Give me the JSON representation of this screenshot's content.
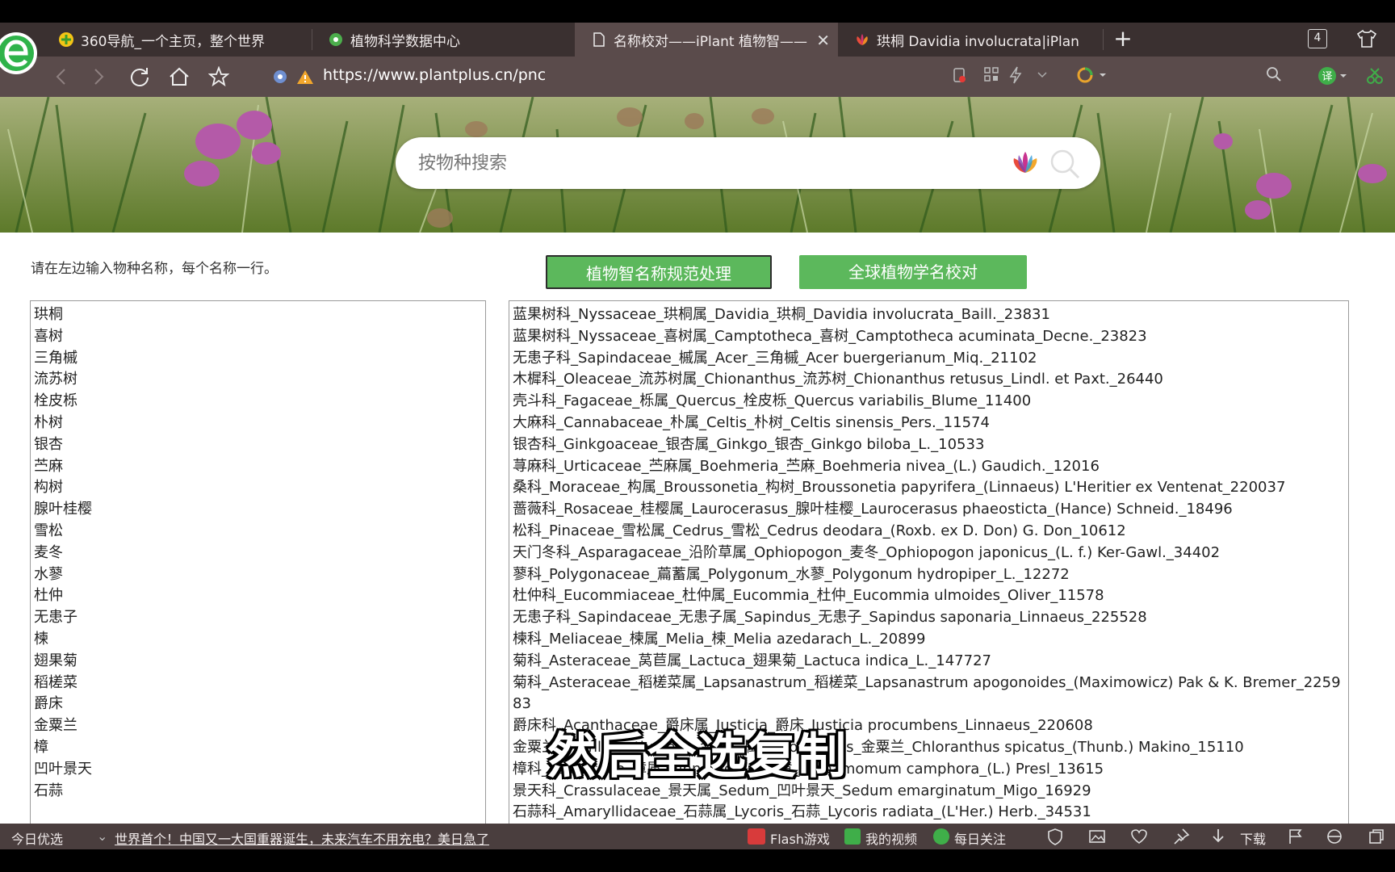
{
  "browser": {
    "tabs": [
      {
        "label": "360导航_一个主页，整个世界",
        "icon": "360-nav-icon"
      },
      {
        "label": "植物科学数据中心",
        "icon": "plant-data-icon"
      },
      {
        "label": "名称校对——iPlant 植物智——",
        "icon": "page-icon"
      },
      {
        "label": "珙桐 Davidia involucrata|iPlant",
        "icon": "lotus-icon"
      }
    ],
    "tab_count": "4",
    "url": "https://www.plantplus.cn/pnc"
  },
  "search": {
    "placeholder": "按物种搜索"
  },
  "page": {
    "hint": "请在左边输入物种名称，每个名称一行。",
    "button_normalize": "植物智名称规范处理",
    "button_global": "全球植物学名校对"
  },
  "input_names": [
    "珙桐",
    "喜树",
    "三角槭",
    "流苏树",
    "栓皮栎",
    "朴树",
    "银杏",
    "苎麻",
    "构树",
    "腺叶桂樱",
    "雪松",
    "麦冬",
    "水蓼",
    "杜仲",
    "无患子",
    "楝",
    "翅果菊",
    "稻槎菜",
    "爵床",
    "金粟兰",
    "樟",
    "凹叶景天",
    "石蒜"
  ],
  "results": [
    "蓝果树科_Nyssaceae_珙桐属_Davidia_珙桐_Davidia involucrata_Baill._23831",
    "蓝果树科_Nyssaceae_喜树属_Camptotheca_喜树_Camptotheca acuminata_Decne._23823",
    "无患子科_Sapindaceae_槭属_Acer_三角槭_Acer buergerianum_Miq._21102",
    "木樨科_Oleaceae_流苏树属_Chionanthus_流苏树_Chionanthus retusus_Lindl. et Paxt._26440",
    "壳斗科_Fagaceae_栎属_Quercus_栓皮栎_Quercus variabilis_Blume_11400",
    "大麻科_Cannabaceae_朴属_Celtis_朴树_Celtis sinensis_Pers._11574",
    "银杏科_Ginkgoaceae_银杏属_Ginkgo_银杏_Ginkgo biloba_L._10533",
    "荨麻科_Urticaceae_苎麻属_Boehmeria_苎麻_Boehmeria nivea_(L.) Gaudich._12016",
    "桑科_Moraceae_构属_Broussonetia_构树_Broussonetia papyrifera_(Linnaeus) L'Heritier ex Ventenat_220037",
    "蔷薇科_Rosaceae_桂樱属_Laurocerasus_腺叶桂樱_Laurocerasus phaeosticta_(Hance) Schneid._18496",
    "松科_Pinaceae_雪松属_Cedrus_雪松_Cedrus deodara_(Roxb. ex D. Don) G. Don_10612",
    "天门冬科_Asparagaceae_沿阶草属_Ophiopogon_麦冬_Ophiopogon japonicus_(L. f.) Ker-Gawl._34402",
    "蓼科_Polygonaceae_萹蓄属_Polygonum_水蓼_Polygonum hydropiper_L._12272",
    "杜仲科_Eucommiaceae_杜仲属_Eucommia_杜仲_Eucommia ulmoides_Oliver_11578",
    "无患子科_Sapindaceae_无患子属_Sapindus_无患子_Sapindus saponaria_Linnaeus_225528",
    "楝科_Meliaceae_楝属_Melia_楝_Melia azedarach_L._20899",
    "菊科_Asteraceae_莴苣属_Lactuca_翅果菊_Lactuca indica_L._147727",
    "菊科_Asteraceae_稻槎菜属_Lapsanastrum_稻槎菜_Lapsanastrum apogonoides_(Maximowicz) Pak & K. Bremer_225983",
    "爵床科_Acanthaceae_爵床属_Justicia_爵床_Justicia procumbens_Linnaeus_220608",
    "金粟兰科_Chloranthaceae_金粟兰属_Chloranthus_金粟兰_Chloranthus spicatus_(Thunb.) Makino_15110",
    "樟科_Lauraceae_樟属_Cinnamomum_樟_Cinnamomum camphora_(L.) Presl_13615",
    "景天科_Crassulaceae_景天属_Sedum_凹叶景天_Sedum emarginatum_Migo_16929",
    "石蒜科_Amaryllidaceae_石蒜属_Lycoris_石蒜_Lycoris radiata_(L'Her.) Herb._34531"
  ],
  "subtitle": "然后全选复制",
  "statusbar": {
    "today": "今日优选",
    "news": "世界首个！中国又一大国重器诞生，未来汽车不用充电？美日急了",
    "flash": "Flash游戏",
    "videos": "我的视频",
    "follow": "每日关注",
    "download": "下载"
  },
  "colors": {
    "accent_green": "#5cb85c",
    "tabbar": "#3a3030",
    "navbar": "#5a4b4b"
  }
}
